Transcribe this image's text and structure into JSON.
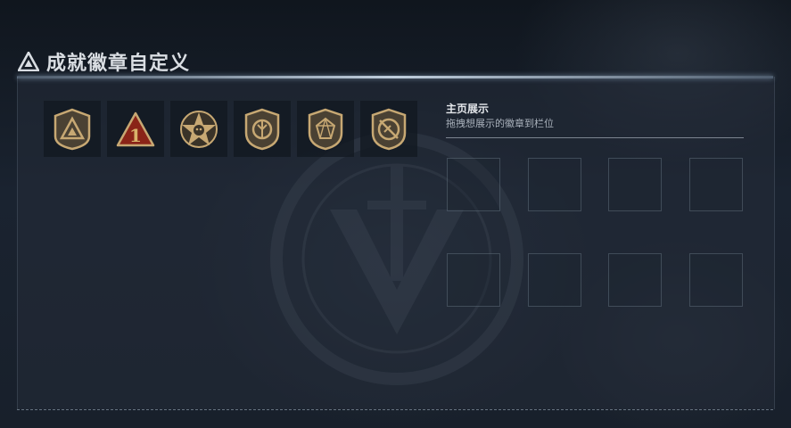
{
  "header": {
    "title": "成就徽章自定义",
    "icon": "triangle-logo-icon"
  },
  "badges": [
    {
      "icon": "triangle-shield-badge-icon"
    },
    {
      "icon": "number-one-triangle-badge-icon"
    },
    {
      "icon": "star-skull-badge-icon"
    },
    {
      "icon": "round-shield-badge-icon"
    },
    {
      "icon": "gem-shield-badge-icon"
    },
    {
      "icon": "crossed-circle-badge-icon"
    }
  ],
  "showcase": {
    "title": "主页展示",
    "subtitle": "拖拽想展示的徽章到栏位",
    "slot_count": 8
  },
  "colors": {
    "badge_gold": "#c7a873",
    "badge_red": "#8a2418",
    "accent_line": "#cfe0f0"
  }
}
